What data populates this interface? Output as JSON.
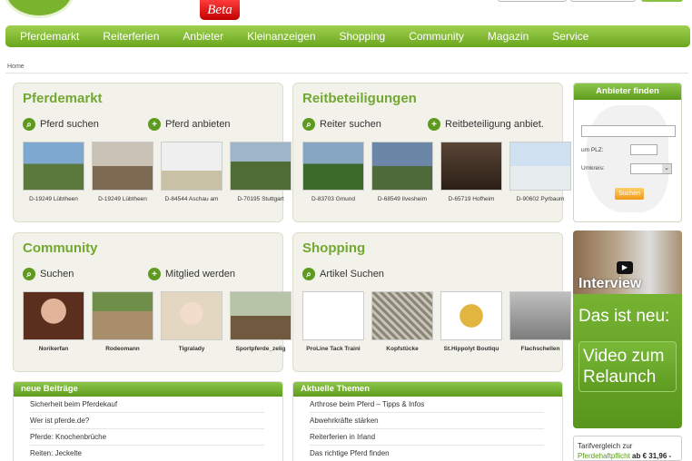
{
  "brand": {
    "beta_label": "Beta"
  },
  "nav": [
    "Pferdemarkt",
    "Reiterferien",
    "Anbieter",
    "Kleinanzeigen",
    "Shopping",
    "Community",
    "Magazin",
    "Service"
  ],
  "breadcrumb": "Home",
  "pferdemarkt": {
    "title": "Pferdemarkt",
    "actions": {
      "search": "Pferd suchen",
      "offer": "Pferd anbieten"
    },
    "items": [
      "D-19249 Lübtheen",
      "D-19249 Lübtheen",
      "D-84544 Aschau am",
      "D-70195 Stuttgart"
    ]
  },
  "reitbeteiligungen": {
    "title": "Reitbeteiligungen",
    "actions": {
      "search": "Reiter suchen",
      "offer": "Reitbeteiligung anbiet."
    },
    "items": [
      "D-83703 Gmund",
      "D-68549 Ilvesheim",
      "D-65719 Hofheim",
      "D-90602 Pyrbaum"
    ]
  },
  "community": {
    "title": "Community",
    "actions": {
      "search": "Suchen",
      "offer": "Mitglied werden"
    },
    "items": [
      "Norikerfan",
      "Rodeomann",
      "Tigralady",
      "Sportpferde_zelig"
    ]
  },
  "shopping": {
    "title": "Shopping",
    "actions": {
      "search": "Artikel Suchen"
    },
    "items": [
      "ProLine Tack Traini",
      "Kopfstücke",
      "St.Hippolyt Boutiqu",
      "Flachschellen"
    ]
  },
  "anbieter_finden": {
    "title": "Anbieter finden",
    "plz_label": "um PLZ:",
    "umkreis_label": "Umkreis:",
    "search_button": "Suchen"
  },
  "promo": {
    "interview": "Interview",
    "new": "Das ist neu:",
    "video": "Video zum Relaunch"
  },
  "tarif": {
    "line1": "Tarifvergleich zur",
    "link": "Pferdehaftpflicht",
    "price": "ab € 31,96 -"
  },
  "neue_beitraege": {
    "title": "neue Beiträge",
    "items": [
      "Sicherheit beim Pferdekauf",
      "Wer ist pferde.de?",
      "Pferde: Knochenbrüche",
      "Reiten: Jeckelte"
    ]
  },
  "aktuelle_themen": {
    "title": "Aktuelle Themen",
    "items": [
      "Arthrose beim Pferd – Tipps & Infos",
      "Abwehrkräfte stärken",
      "Reiterferien in Irland",
      "Das richtige Pferd finden"
    ]
  }
}
